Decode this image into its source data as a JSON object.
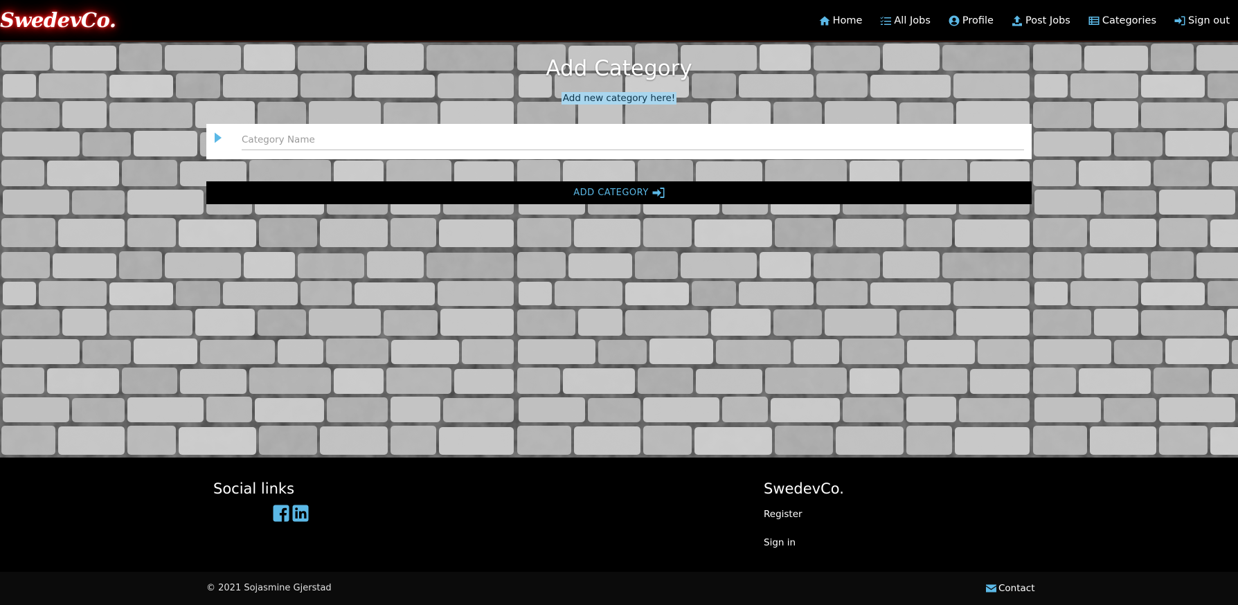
{
  "brand": "SwedevCo.",
  "nav": [
    {
      "label": "Home",
      "icon": "home-icon"
    },
    {
      "label": "All Jobs",
      "icon": "list-icon"
    },
    {
      "label": "Profile",
      "icon": "user-circle-icon"
    },
    {
      "label": "Post Jobs",
      "icon": "upload-icon"
    },
    {
      "label": "Categories",
      "icon": "categories-icon"
    },
    {
      "label": "Sign out",
      "icon": "sign-out-icon"
    }
  ],
  "form": {
    "title": "Add Category",
    "subtitle": "Add new category here!",
    "input_placeholder": "Category Name",
    "input_value": "",
    "submit_label": "ADD CATEGORY"
  },
  "footer": {
    "social_title": "Social links",
    "social_icons": [
      "facebook-icon",
      "linkedin-icon"
    ],
    "brand_title": "SwedevCo.",
    "links": [
      "Register",
      "Sign in"
    ],
    "copyright": "© 2021 Sojasmine Gjerstad",
    "contact_label": "Contact"
  },
  "colors": {
    "accent": "#5bb8e6",
    "background": "#000000",
    "subtitle_highlight": "#a9d6ee",
    "brand_glow": "#ff2a2a"
  }
}
